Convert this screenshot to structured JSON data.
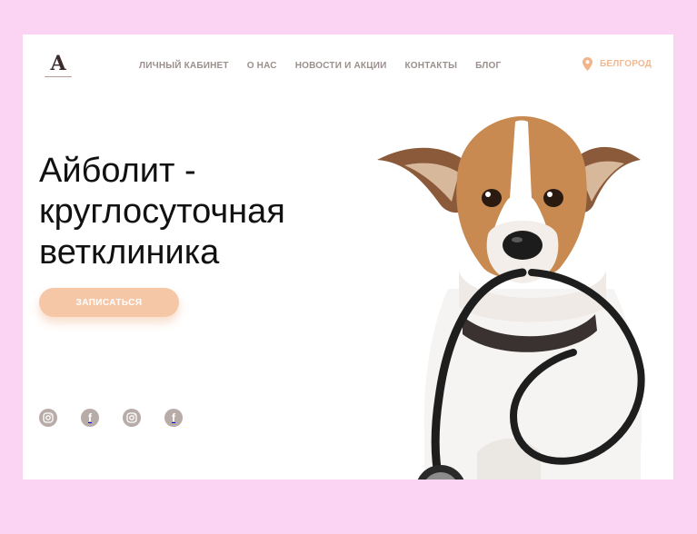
{
  "logo": {
    "letter": "A"
  },
  "nav": {
    "items": [
      {
        "label": "ЛИЧНЫЙ КАБИНЕТ"
      },
      {
        "label": "О НАС"
      },
      {
        "label": "НОВОСТИ И АКЦИИ"
      },
      {
        "label": "КОНТАКТЫ"
      },
      {
        "label": "БЛОГ"
      }
    ]
  },
  "location": {
    "city": "БЕЛГОРОД",
    "icon": "map-pin-icon"
  },
  "hero": {
    "title_lines": [
      "Айболит -",
      "круглосуточная",
      "ветклиника"
    ],
    "cta_label": "ЗАПИСАТЬСЯ"
  },
  "socials": [
    {
      "icon": "instagram-icon"
    },
    {
      "icon": "facebook-icon"
    },
    {
      "icon": "instagram-icon"
    },
    {
      "icon": "facebook-icon"
    }
  ],
  "colors": {
    "background": "#fbd4f4",
    "accent": "#f6c7a7",
    "city": "#f0b993",
    "nav_text": "#9b8f8d",
    "social": "#b8aca9"
  }
}
